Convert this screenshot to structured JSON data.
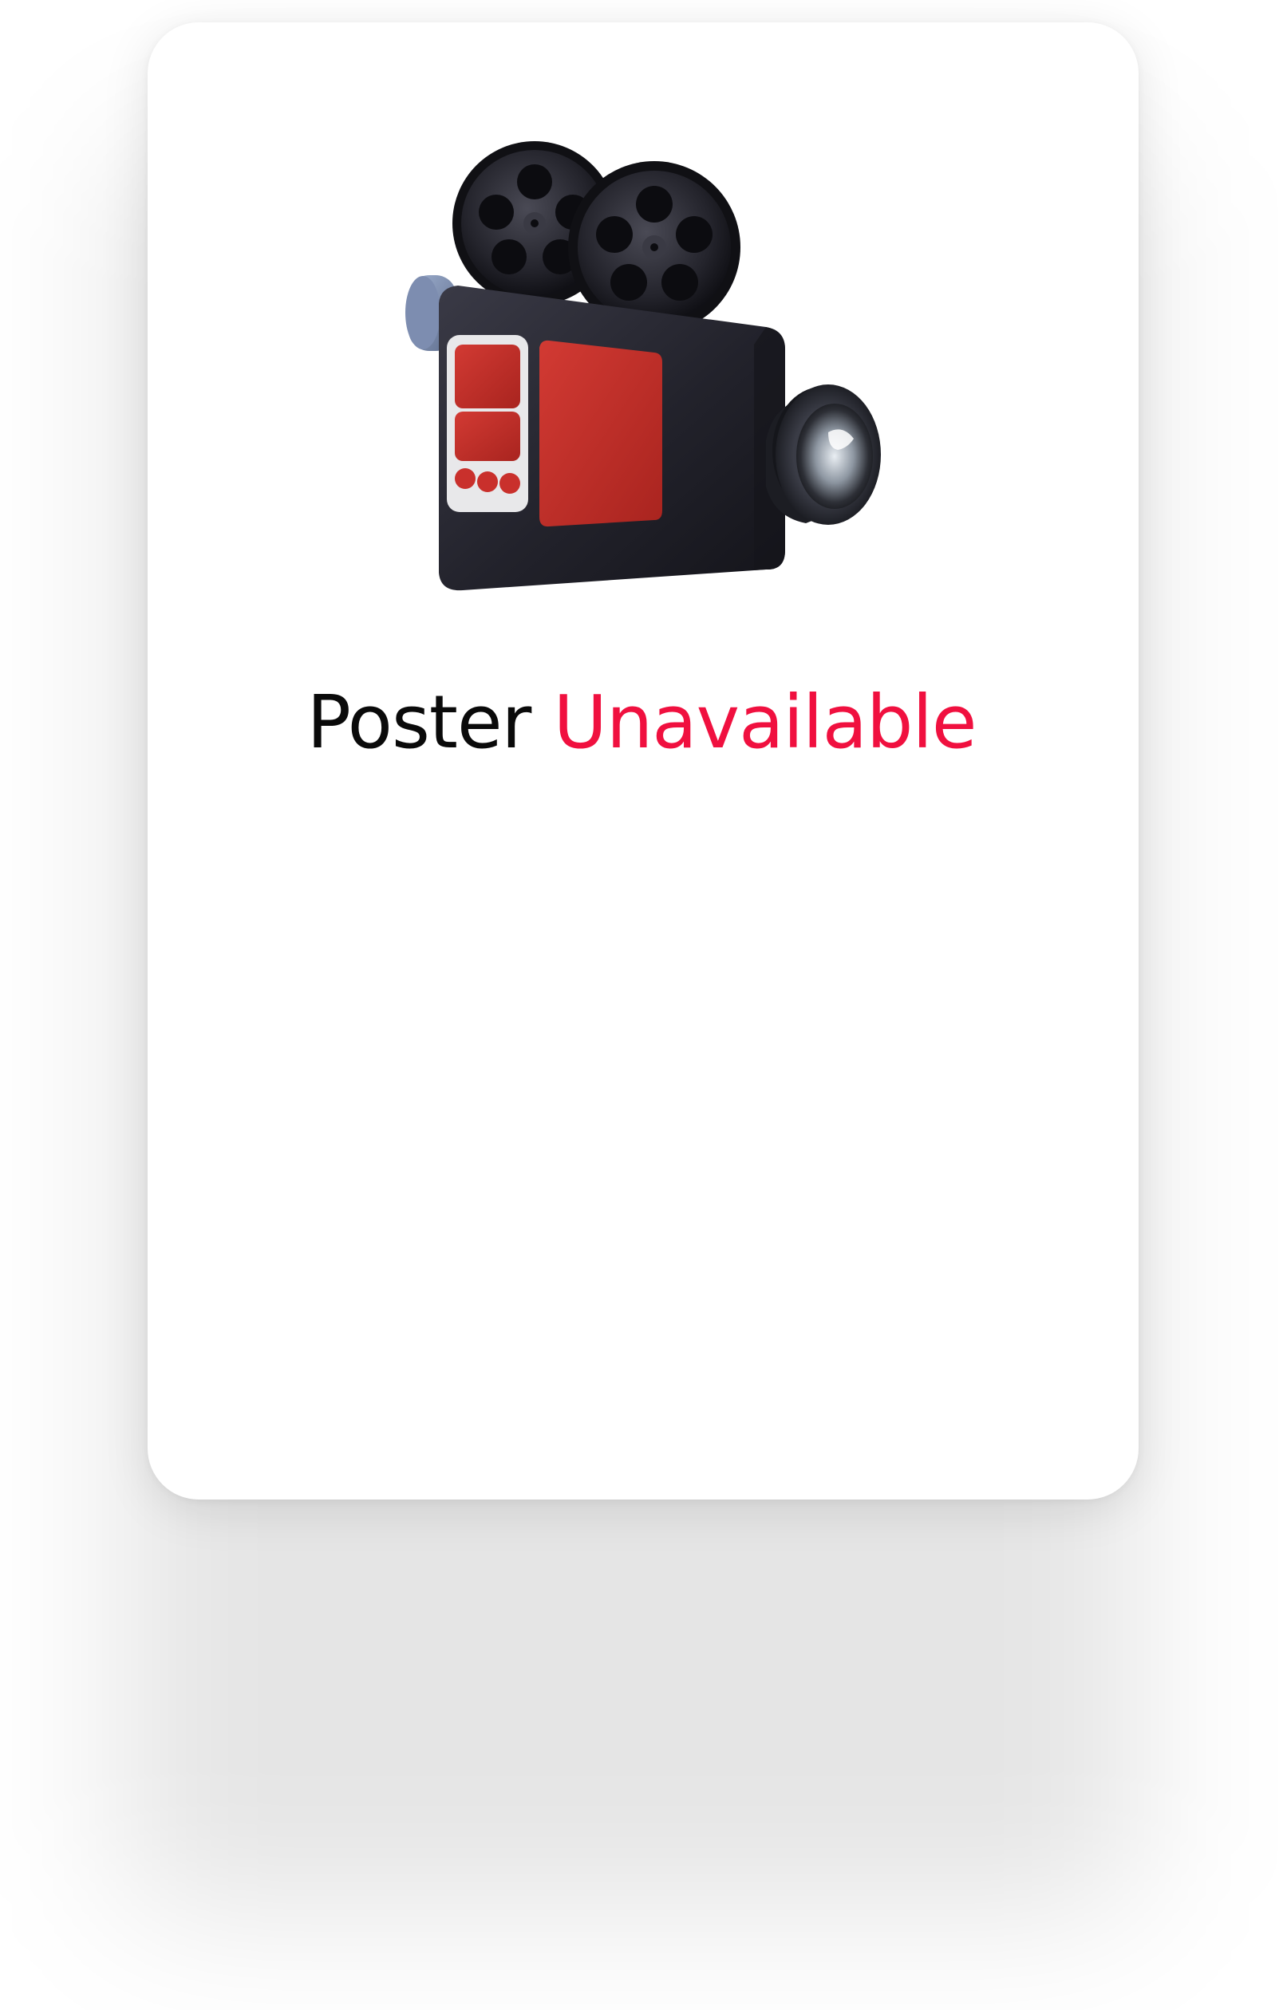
{
  "placeholder": {
    "title_word_1": "Poster",
    "title_word_2": "Unavailable",
    "illustration_icon": "movie-camera-icon"
  },
  "colors": {
    "title_dark": "#0a0a0a",
    "title_accent": "#f0103f",
    "card_background": "#ffffff",
    "camera_body": "#23232c",
    "camera_panel": "#c9302c"
  }
}
